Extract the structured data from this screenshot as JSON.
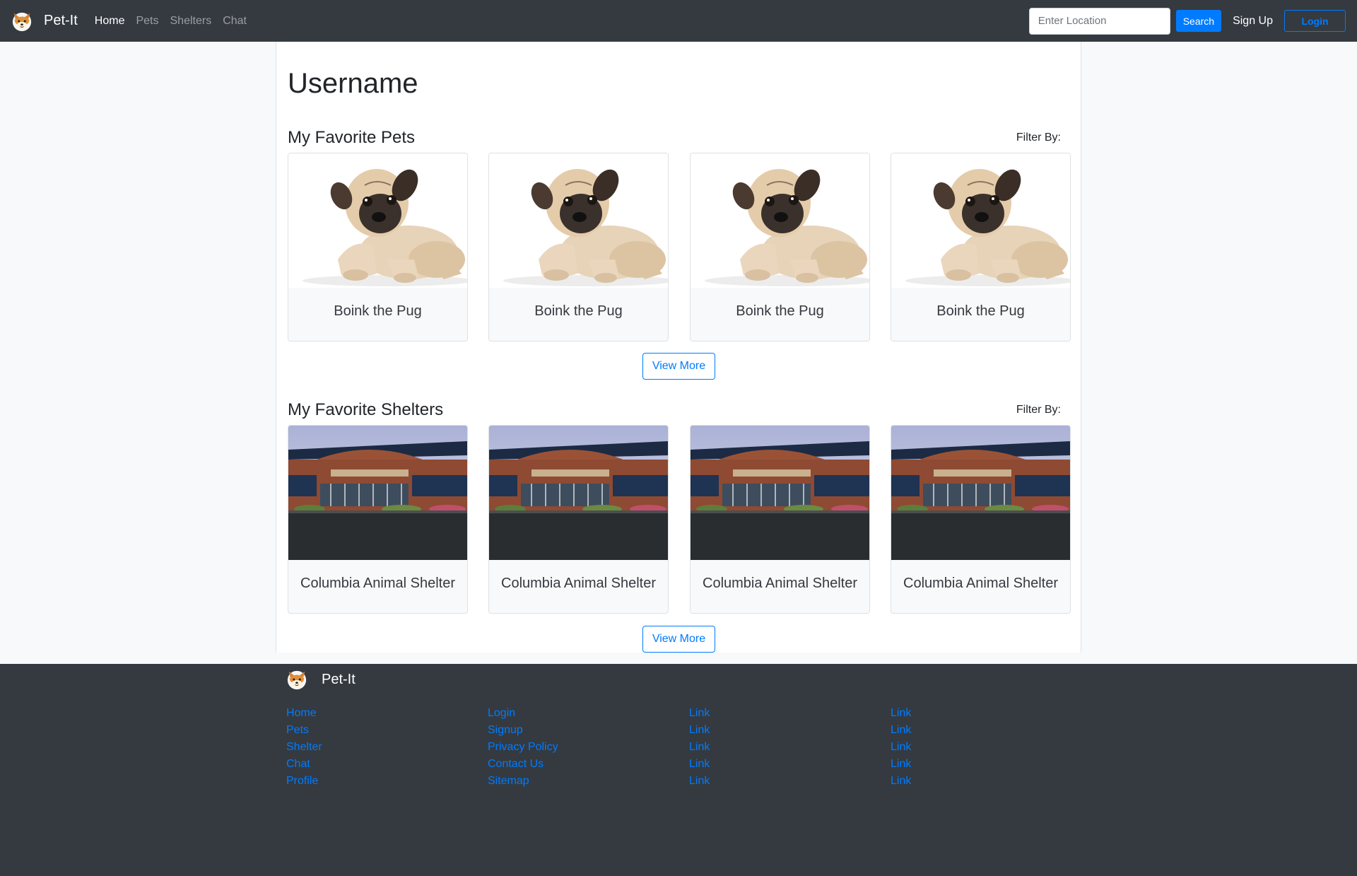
{
  "navbar": {
    "brand": "Pet-It",
    "links": [
      "Home",
      "Pets",
      "Shelters",
      "Chat"
    ],
    "location_placeholder": "Enter Location",
    "search_label": "Search",
    "signup_label": "Sign Up",
    "login_label": "Login"
  },
  "profile": {
    "username": "Username"
  },
  "favorite_pets": {
    "title": "My Favorite Pets",
    "filter_label": "Filter By:",
    "cards": [
      {
        "name": "Boink the Pug",
        "image": "pug-photo"
      },
      {
        "name": "Boink the Pug",
        "image": "pug-photo"
      },
      {
        "name": "Boink the Pug",
        "image": "pug-photo"
      },
      {
        "name": "Boink the Pug",
        "image": "pug-photo"
      }
    ],
    "view_more_label": "View More"
  },
  "favorite_shelters": {
    "title": "My Favorite Shelters",
    "filter_label": "Filter By:",
    "cards": [
      {
        "name": "Columbia Animal Shelter",
        "image": "shelter-building-photo"
      },
      {
        "name": "Columbia Animal Shelter",
        "image": "shelter-building-photo"
      },
      {
        "name": "Columbia Animal Shelter",
        "image": "shelter-building-photo"
      },
      {
        "name": "Columbia Animal Shelter",
        "image": "shelter-building-photo"
      }
    ],
    "view_more_label": "View More"
  },
  "footer": {
    "brand": "Pet-It",
    "columns": [
      [
        "Home",
        "Pets",
        "Shelter",
        "Chat",
        "Profile"
      ],
      [
        "Login",
        "Signup",
        "Privacy Policy",
        "Contact Us",
        "Sitemap"
      ],
      [
        "Link",
        "Link",
        "Link",
        "Link",
        "Link"
      ],
      [
        "Link",
        "Link",
        "Link",
        "Link",
        "Link"
      ]
    ]
  },
  "colors": {
    "navbar_bg": "#343a40",
    "primary": "#007bff",
    "page_bg": "#f8f9fa",
    "card_bg": "#f8f9fa"
  },
  "icons": {
    "brand": "shiba-dog-face-icon"
  }
}
